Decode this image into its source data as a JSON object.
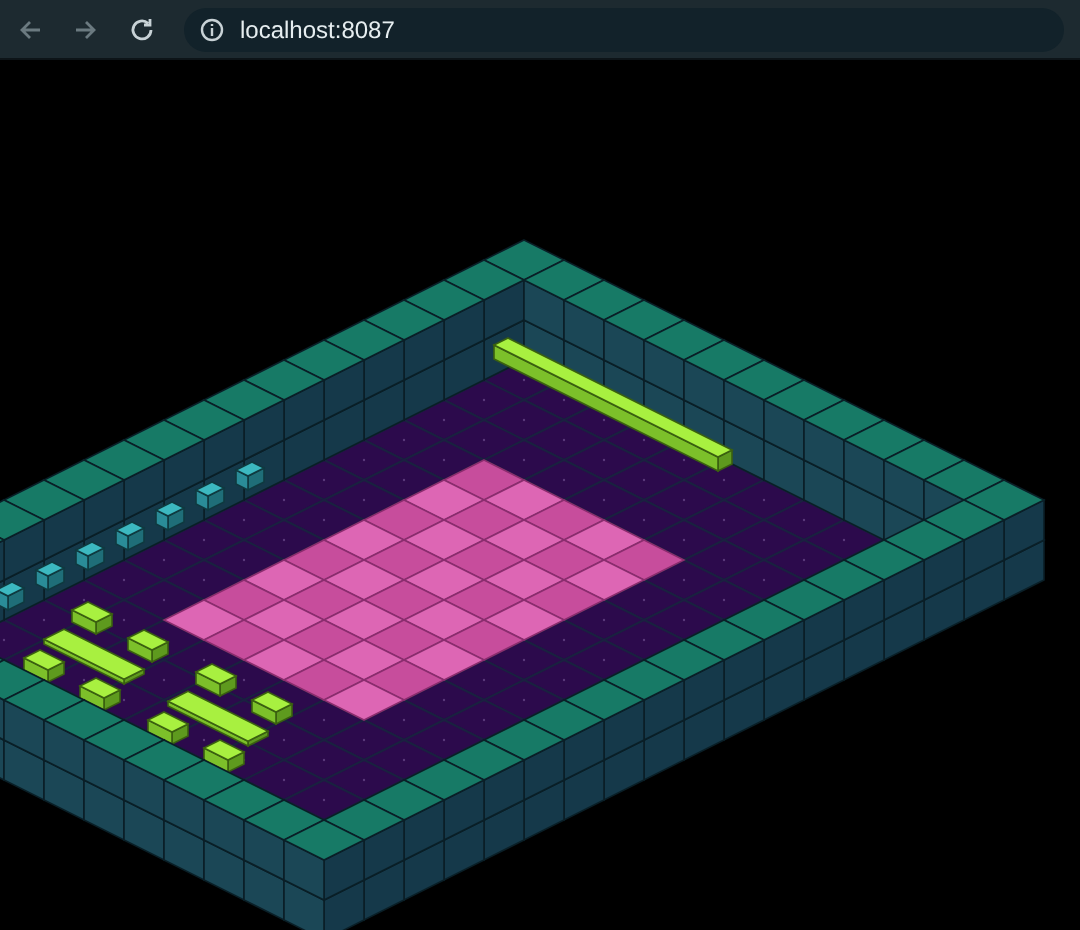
{
  "browser": {
    "address": "localhost:8087"
  }
}
